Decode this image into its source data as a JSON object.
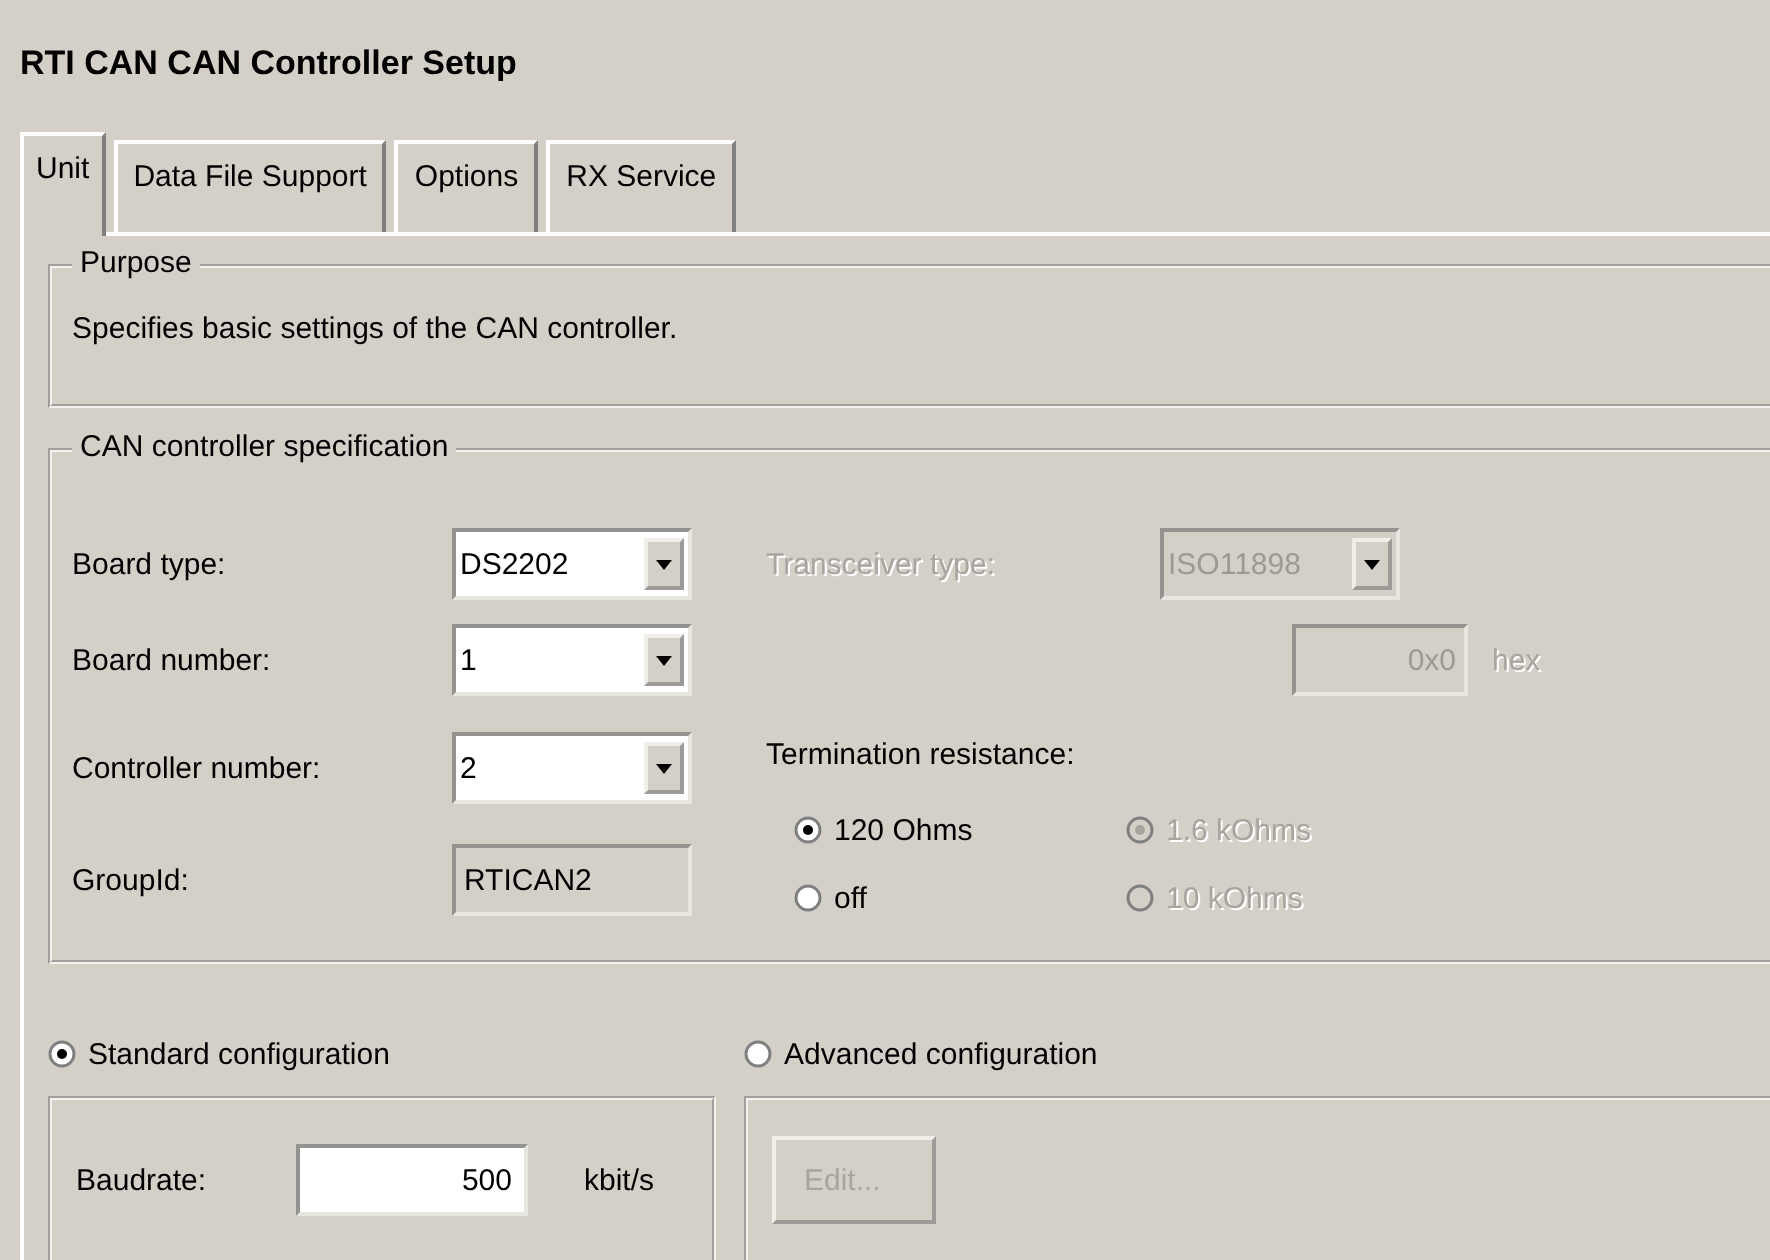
{
  "title": "RTI CAN  CAN Controller Setup",
  "tabs": [
    {
      "label": "Unit",
      "selected": true
    },
    {
      "label": "Data File Support",
      "selected": false
    },
    {
      "label": "Options",
      "selected": false
    },
    {
      "label": "RX Service",
      "selected": false
    }
  ],
  "purpose": {
    "legend": "Purpose",
    "text": "Specifies basic settings of the CAN controller."
  },
  "spec": {
    "legend": "CAN controller specification",
    "fields": [
      {
        "label": "Board type:",
        "value": "DS2202",
        "kind": "combo"
      },
      {
        "label": "Board number:",
        "value": "1",
        "kind": "combo"
      },
      {
        "label": "Controller number:",
        "value": "2",
        "kind": "combo"
      },
      {
        "label": "GroupId:",
        "value": "RTICAN2",
        "kind": "readonly"
      }
    ],
    "transceiver": {
      "label": "Transceiver type:",
      "value": "ISO11898",
      "disabled": true
    },
    "address": {
      "value": "0x0",
      "unit": "hex",
      "disabled": true
    },
    "termination": {
      "label": "Termination resistance:",
      "options": [
        {
          "label": "120 Ohms",
          "selected": true,
          "disabled": false
        },
        {
          "label": "1.6 kOhms",
          "selected": true,
          "disabled": true
        },
        {
          "label": "off",
          "selected": false,
          "disabled": false
        },
        {
          "label": "10 kOhms",
          "selected": false,
          "disabled": true
        }
      ]
    }
  },
  "standard": {
    "label": "Standard configuration",
    "selected": true,
    "baudrate": {
      "label": "Baudrate:",
      "value": "500",
      "unit": "kbit/s"
    }
  },
  "advanced": {
    "label": "Advanced configuration",
    "selected": false,
    "edit_button": {
      "label": "Edit...",
      "disabled": true
    }
  }
}
